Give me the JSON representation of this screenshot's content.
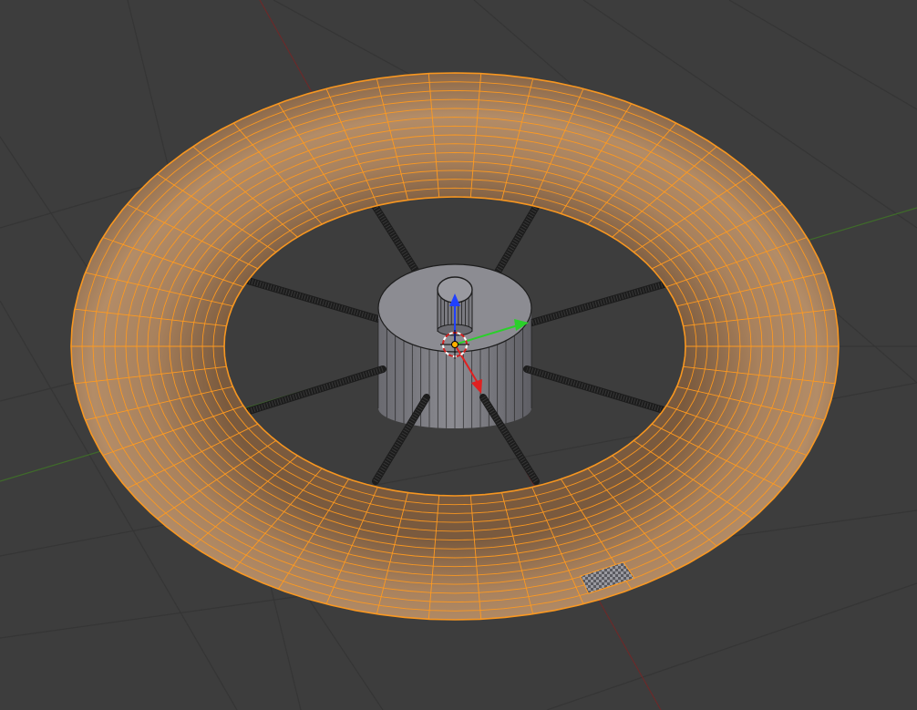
{
  "viewport": {
    "background": "#3d3d3d",
    "grid_color": "#353535",
    "x_axis_color": "#6a2a2a",
    "y_axis_color": "#3f6b2a"
  },
  "torus": {
    "base_color": "#b08a65",
    "edge_color": "#ff9a1f",
    "selected_face_color": "#8a8a8a",
    "rings": 46,
    "segments": 14
  },
  "hub": {
    "color": "#8c8c92",
    "wire_color": "#1e1e1e"
  },
  "spokes": {
    "count": 8,
    "color": "#1c1c1c"
  },
  "gizmo": {
    "x_color": "#e02020",
    "y_color": "#2ad02a",
    "z_color": "#2040ff",
    "origin_color": "#ffb000"
  },
  "icons": [
    "3d-cursor-icon",
    "object-origin-icon",
    "transform-gizmo-icon"
  ]
}
